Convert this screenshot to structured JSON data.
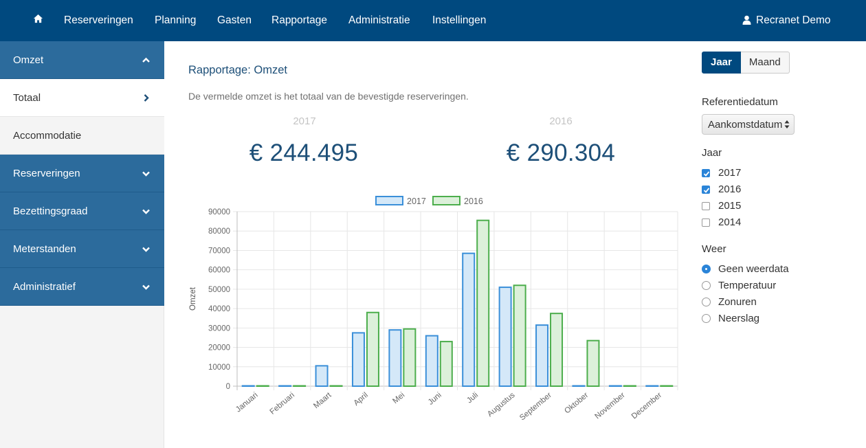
{
  "nav": {
    "items": [
      "Reserveringen",
      "Planning",
      "Gasten",
      "Rapportage",
      "Administratie",
      "Instellingen"
    ],
    "user": "Recranet Demo"
  },
  "sidebar": {
    "items": [
      {
        "label": "Omzet",
        "style": "section",
        "chevron": "chevron-up"
      },
      {
        "label": "Totaal",
        "style": "active",
        "chevron": "chevron-right"
      },
      {
        "label": "Accommodatie",
        "style": "sub"
      },
      {
        "label": "Reserveringen",
        "style": "section",
        "chevron": "chevron-down"
      },
      {
        "label": "Bezettingsgraad",
        "style": "section",
        "chevron": "chevron-down"
      },
      {
        "label": "Meterstanden",
        "style": "section",
        "chevron": "chevron-down"
      },
      {
        "label": "Administratief",
        "style": "section",
        "chevron": "chevron-down"
      }
    ]
  },
  "main": {
    "title": "Rapportage: Omzet",
    "description": "De vermelde omzet is het totaal van de bevestigde reserveringen.",
    "stats": [
      {
        "year": "2017",
        "value": "€ 244.495"
      },
      {
        "year": "2016",
        "value": "€ 290.304"
      }
    ]
  },
  "panel": {
    "toggle": {
      "active": "Jaar",
      "inactive": "Maand"
    },
    "ref_label": "Referentiedatum",
    "ref_value": "Aankomstdatum",
    "year_label": "Jaar",
    "years": [
      {
        "label": "2017",
        "checked": true
      },
      {
        "label": "2016",
        "checked": true
      },
      {
        "label": "2015",
        "checked": false
      },
      {
        "label": "2014",
        "checked": false
      }
    ],
    "weather_label": "Weer",
    "weather": [
      {
        "label": "Geen weerdata",
        "checked": true
      },
      {
        "label": "Temperatuur",
        "checked": false
      },
      {
        "label": "Zonuren",
        "checked": false
      },
      {
        "label": "Neerslag",
        "checked": false
      }
    ]
  },
  "colors": {
    "nav": "#00497f",
    "sidebar_section": "#2c6b9c",
    "series_2017": "#3a8fd9",
    "series_2017_fill": "#d4e8f8",
    "series_2016": "#4cae4c",
    "series_2016_fill": "#dcf0da"
  },
  "chart_data": {
    "type": "bar",
    "categories": [
      "Januari",
      "Februari",
      "Maart",
      "April",
      "Mei",
      "Juni",
      "Juli",
      "Augustus",
      "September",
      "Oktober",
      "November",
      "December"
    ],
    "series": [
      {
        "name": "2017",
        "values": [
          0,
          0,
          10500,
          27500,
          29000,
          26000,
          68500,
          51000,
          31500,
          0,
          0,
          0
        ]
      },
      {
        "name": "2016",
        "values": [
          0,
          0,
          0,
          38000,
          29500,
          23000,
          85500,
          52000,
          37500,
          23500,
          0,
          0
        ]
      }
    ],
    "ylabel": "Omzet",
    "xlabel": "",
    "ylim": [
      0,
      90000
    ],
    "yticks": [
      "90000",
      "80000",
      "70000",
      "60000",
      "50000",
      "40000",
      "30000",
      "20000",
      "10000",
      "0"
    ],
    "grid": true,
    "legend": "top-center"
  }
}
